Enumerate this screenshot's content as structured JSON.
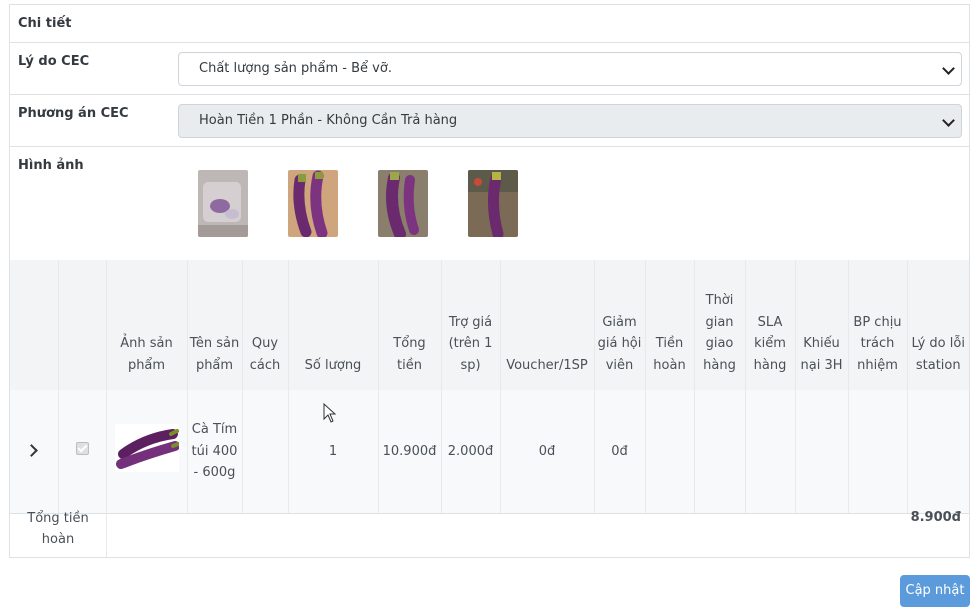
{
  "details": {
    "header_label": "Chi tiết",
    "reason_label": "Lý do CEC",
    "reason_value": "Chất lượng sản phẩm - Bể vỡ.",
    "plan_label": "Phương án CEC",
    "plan_value": "Hoàn Tiền 1 Phần - Không Cần Trả hàng",
    "images_label": "Hình ảnh"
  },
  "table": {
    "headers": [
      "",
      "",
      "Ảnh sản phẩm",
      "Tên sản phẩm",
      "Quy cách",
      "Số lượng",
      "Tổng tiền",
      "Trợ giá (trên 1 sp)",
      "Voucher/1SP",
      "Giảm giá hội viên",
      "Tiền hoàn",
      "Thời gian giao hàng",
      "SLA kiểm hàng",
      "Khiếu nại 3H",
      "BP chịu trách nhiệm",
      "Lý do lỗi station"
    ],
    "row": {
      "product_name": "Cà Tím túi 400 - 600g",
      "spec": "",
      "quantity": "1",
      "total": "10.900đ",
      "subsidy": "2.000đ",
      "voucher": "0đ",
      "member_discount": "0đ",
      "refund": "",
      "delivery_time": "",
      "sla": "",
      "complaint": "",
      "bp": "",
      "station_reason": ""
    }
  },
  "total": {
    "label": "Tổng tiền hoàn",
    "value": "8.900đ"
  },
  "update_button": "Cập nhật",
  "colors": {
    "primary": "#5b9bdc",
    "eggplant": "#6b2a6e"
  }
}
